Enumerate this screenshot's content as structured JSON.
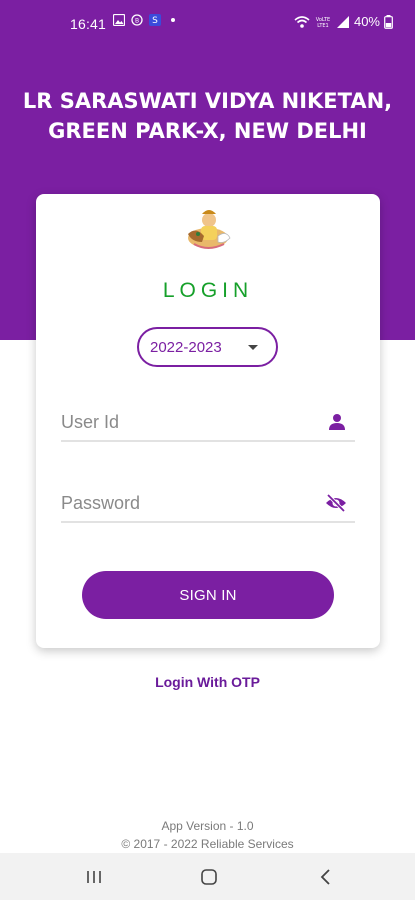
{
  "status_bar": {
    "time": "16:41",
    "battery": "40%",
    "icons_left": [
      "gallery-icon",
      "whatsapp-icon",
      "app-s-icon",
      "dot-icon"
    ],
    "icons_right": [
      "wifi-icon",
      "volte-icon",
      "signal-icon"
    ],
    "volte_label": "VoLTE"
  },
  "header": {
    "school_name": "LR SARASWATI VIDYA NIKETAN, GREEN PARK-X, NEW DELHI",
    "bg_color": "#7b1fa2"
  },
  "login_card": {
    "title": "LOGIN",
    "year_selected": "2022-2023",
    "user_id": {
      "value": "",
      "placeholder": "User Id",
      "icon": "person-icon"
    },
    "password": {
      "value": "",
      "placeholder": "Password",
      "icon": "eye-off-icon"
    },
    "signin_label": "SIGN IN",
    "title_color": "#16a02a",
    "accent_color": "#7b1fa2"
  },
  "otp_link": "Login With OTP",
  "footer": {
    "app_version": "App Version - 1.0",
    "copyright": "© 2017 - 2022 Reliable Services"
  },
  "nav_bar": {
    "buttons": [
      "recents-icon",
      "home-icon",
      "back-icon"
    ]
  }
}
